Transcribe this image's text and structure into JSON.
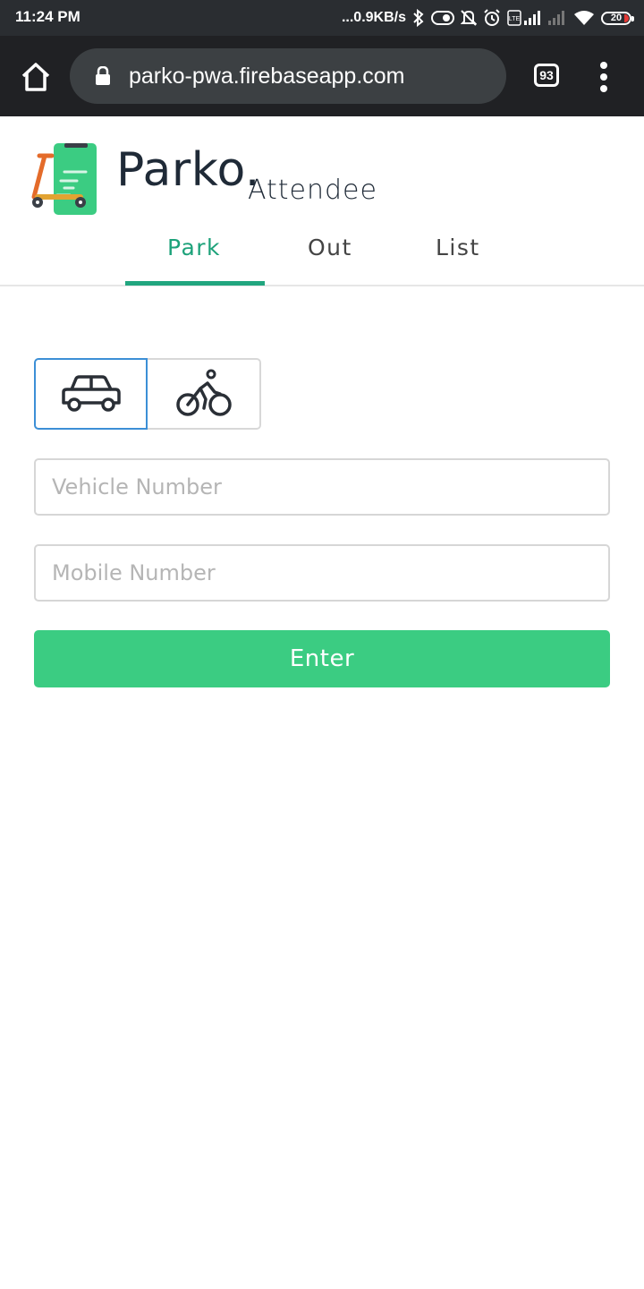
{
  "status_bar": {
    "time": "11:24 PM",
    "network_speed": "...0.9KB/s",
    "battery": "20"
  },
  "browser": {
    "url": "parko-pwa.firebaseapp.com",
    "tab_count": "93"
  },
  "header": {
    "brand": "Parko.",
    "role": "Attendee"
  },
  "tabs": [
    {
      "label": "Park",
      "active": true
    },
    {
      "label": "Out",
      "active": false
    },
    {
      "label": "List",
      "active": false
    }
  ],
  "form": {
    "vehicle_types": [
      "car",
      "bike"
    ],
    "selected_vehicle": "car",
    "vehicle_number": {
      "value": "",
      "placeholder": "Vehicle Number"
    },
    "mobile_number": {
      "value": "",
      "placeholder": "Mobile Number"
    },
    "submit_label": "Enter"
  },
  "colors": {
    "accent": "#21a67f",
    "button": "#3bcc82",
    "selected_border": "#3c8fd6",
    "status_bar": "#2a2d31",
    "browser_bar": "#202124"
  }
}
